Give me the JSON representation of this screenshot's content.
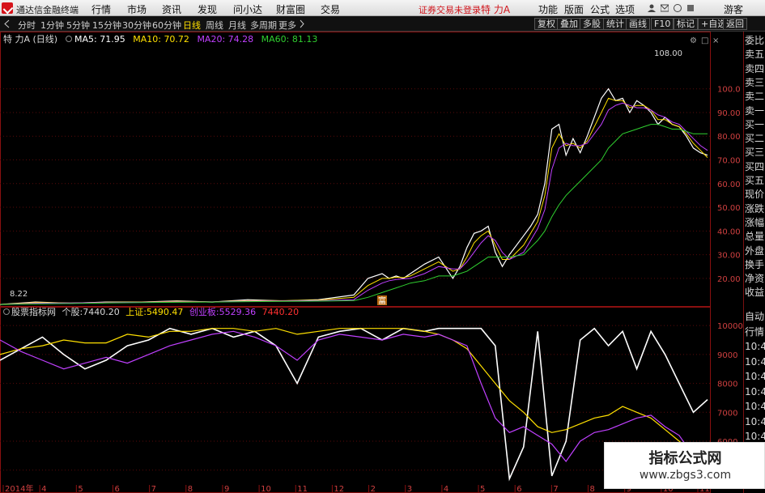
{
  "app": {
    "title": "通达信金融终端"
  },
  "top_menu": [
    "行情",
    "市场",
    "资讯",
    "发现",
    "问小达",
    "财富圈",
    "交易"
  ],
  "status_text": "证券交易未登录",
  "stock_name": "特 力A",
  "top_right": [
    "功能",
    "版面",
    "公式",
    "选项"
  ],
  "guest": "游客",
  "period_tabs": [
    "分时",
    "1分钟",
    "5分钟",
    "15分钟",
    "30分钟",
    "60分钟",
    "日线",
    "周线",
    "月线",
    "多周期",
    "更多"
  ],
  "active_period": "日线",
  "right_buttons": [
    "复权",
    "叠加",
    "多股",
    "统计",
    "画线",
    "F10",
    "标记",
    "+自选",
    "返回"
  ],
  "main_chart": {
    "stock_label": "特 力A (日线)",
    "ma": [
      {
        "name": "MA5",
        "value": "71.95",
        "color": "#ffffff"
      },
      {
        "name": "MA10",
        "value": "70.72",
        "color": "#ffe000"
      },
      {
        "name": "MA20",
        "value": "74.28",
        "color": "#c040ff"
      },
      {
        "name": "MA60",
        "value": "81.13",
        "color": "#30d030"
      }
    ],
    "high_label": "108.00",
    "low_label": "8.22",
    "marker": "富"
  },
  "sub_chart": {
    "name": "股票指标网",
    "items": [
      {
        "label": "个股:",
        "value": "7440.20",
        "color": "#d8d8d8"
      },
      {
        "label": "上证:",
        "value": "5490.47",
        "color": "#ffe000"
      },
      {
        "label": "创业板:",
        "value": "5529.36",
        "color": "#c040ff"
      },
      {
        "label": "",
        "value": "7440.20",
        "color": "#ff3030"
      }
    ]
  },
  "chart_data": [
    {
      "type": "line",
      "title": "特 力A (日线)",
      "ylim": [
        8,
        118
      ],
      "yticks": [
        "100.0",
        "90.00",
        "80.00",
        "70.00",
        "60.00",
        "50.00",
        "40.00",
        "30.00",
        "20.00"
      ],
      "x": [
        0,
        5,
        10,
        15,
        20,
        25,
        30,
        35,
        40,
        45,
        50,
        52,
        54,
        55,
        56,
        57,
        58,
        60,
        62,
        64,
        65,
        66,
        67,
        68,
        69,
        70,
        71,
        72,
        74,
        75,
        76,
        77,
        78,
        79,
        80,
        81,
        82,
        83,
        85,
        86,
        87,
        88,
        89,
        90,
        91,
        92,
        93,
        94,
        95,
        96,
        97,
        98,
        99,
        100
      ],
      "series": [
        {
          "name": "MA5",
          "color": "#ffffff",
          "values": [
            9,
            10,
            9.5,
            10,
            10,
            10.5,
            10,
            11,
            10.5,
            11,
            13,
            20,
            22,
            20,
            21,
            20,
            22,
            26,
            29,
            20,
            25,
            33,
            39,
            40,
            42,
            31,
            25,
            30,
            38,
            42,
            47,
            60,
            83,
            85,
            72,
            79,
            73,
            80,
            96,
            100,
            95,
            96,
            90,
            95,
            93,
            90,
            85,
            88,
            85,
            84,
            80,
            75,
            73,
            72
          ]
        },
        {
          "name": "MA10",
          "color": "#ffe000",
          "values": [
            9,
            9.8,
            9.6,
            9.9,
            10,
            10.3,
            10.1,
            10.6,
            10.6,
            10.8,
            12,
            17,
            20,
            20,
            20.5,
            20.3,
            21,
            24,
            27,
            23,
            24,
            29,
            35,
            38,
            40,
            34,
            28,
            28,
            34,
            39,
            44,
            55,
            75,
            81,
            76,
            77,
            75,
            78,
            90,
            96,
            95,
            95,
            92,
            93,
            93,
            91,
            87,
            87,
            85,
            84,
            81,
            77,
            74,
            71
          ]
        },
        {
          "name": "MA20",
          "color": "#c040ff",
          "values": [
            9,
            9.5,
            9.6,
            9.8,
            9.9,
            10.1,
            10.1,
            10.4,
            10.5,
            10.6,
            11,
            15,
            18,
            19,
            19.5,
            19.8,
            20,
            22,
            25,
            24,
            24,
            27,
            31,
            35,
            38,
            36,
            31,
            28,
            31,
            36,
            41,
            49,
            66,
            75,
            77,
            76,
            76,
            77,
            85,
            91,
            93,
            94,
            93,
            92,
            92,
            91,
            89,
            88,
            86,
            85,
            82,
            79,
            76,
            74
          ]
        },
        {
          "name": "MA60",
          "color": "#30d030",
          "values": [
            9,
            9.2,
            9.4,
            9.6,
            9.8,
            9.9,
            10,
            10.2,
            10.3,
            10.4,
            10.6,
            12,
            14,
            15,
            16,
            17,
            18,
            19,
            21,
            21,
            22,
            23,
            25,
            27,
            29,
            29,
            29,
            29,
            30,
            33,
            36,
            40,
            46,
            51,
            55,
            58,
            61,
            64,
            70,
            75,
            78,
            81,
            82,
            83,
            84,
            85,
            85,
            84,
            83,
            83,
            82,
            81,
            81,
            81
          ]
        }
      ]
    },
    {
      "type": "line",
      "title": "股票指标网",
      "ylim": [
        4600,
        10200
      ],
      "yticks": [
        "10000",
        "9000",
        "8000",
        "7000",
        "6000",
        "5000"
      ],
      "x": [
        0,
        3,
        6,
        9,
        12,
        15,
        18,
        21,
        24,
        27,
        30,
        33,
        36,
        39,
        42,
        45,
        48,
        51,
        54,
        57,
        60,
        62,
        64,
        66,
        68,
        70,
        72,
        74,
        76,
        78,
        80,
        82,
        84,
        86,
        88,
        90,
        92,
        94,
        96,
        98,
        100
      ],
      "series": [
        {
          "name": "个股",
          "color": "#ffffff",
          "values": [
            8800,
            9200,
            9600,
            9000,
            8500,
            8800,
            9300,
            9500,
            9900,
            9700,
            9900,
            9600,
            9800,
            9300,
            8000,
            9600,
            9800,
            9900,
            9500,
            9900,
            9800,
            9900,
            9900,
            9900,
            9900,
            9300,
            4700,
            5800,
            9800,
            4800,
            6000,
            9500,
            9900,
            9300,
            9800,
            8500,
            9800,
            9000,
            8000,
            7000,
            7440
          ]
        },
        {
          "name": "上证",
          "color": "#ffe000",
          "values": [
            9000,
            9200,
            9300,
            9500,
            9400,
            9400,
            9700,
            9600,
            9800,
            9800,
            9900,
            9900,
            9800,
            9900,
            9700,
            9800,
            9900,
            9900,
            9900,
            9900,
            9800,
            9700,
            9500,
            9200,
            8600,
            8000,
            7400,
            7000,
            6500,
            6300,
            6400,
            6600,
            6800,
            6900,
            7200,
            7000,
            6800,
            6400,
            6000,
            5600,
            5490
          ]
        },
        {
          "name": "创业板",
          "color": "#c040ff",
          "values": [
            9500,
            9100,
            8800,
            8500,
            8700,
            8900,
            8700,
            9000,
            9300,
            9500,
            9700,
            9800,
            9600,
            9300,
            8800,
            9500,
            9700,
            9600,
            9500,
            9700,
            9600,
            9700,
            9500,
            9300,
            8000,
            6800,
            6300,
            6500,
            6200,
            5900,
            5300,
            6000,
            6300,
            6400,
            6600,
            6800,
            6900,
            6500,
            6200,
            5500,
            5529
          ]
        }
      ]
    }
  ],
  "x_axis_labels": [
    "2014年",
    "4",
    "5",
    "6",
    "7",
    "8",
    "9",
    "10",
    "11",
    "12",
    "2",
    "3",
    "4",
    "5",
    "6",
    "7",
    "8",
    "9",
    "10",
    "11"
  ],
  "right_panel": [
    "委比",
    "卖五",
    "卖四",
    "卖三",
    "卖二",
    "卖一",
    "买一",
    "买二",
    "买三",
    "买四",
    "买五",
    "现价",
    "涨跌",
    "涨幅",
    "总量",
    "外盘",
    "换手",
    "净资",
    "收益"
  ],
  "right_panel_lower": [
    "自动",
    "行情",
    "10:4",
    "10:4",
    "10:4",
    "10:4",
    "10:4",
    "10:4",
    "10:4",
    "10:4",
    "10:4"
  ],
  "watermark": {
    "line1": "指标公式网",
    "line2": "www.zbgs3.com"
  }
}
